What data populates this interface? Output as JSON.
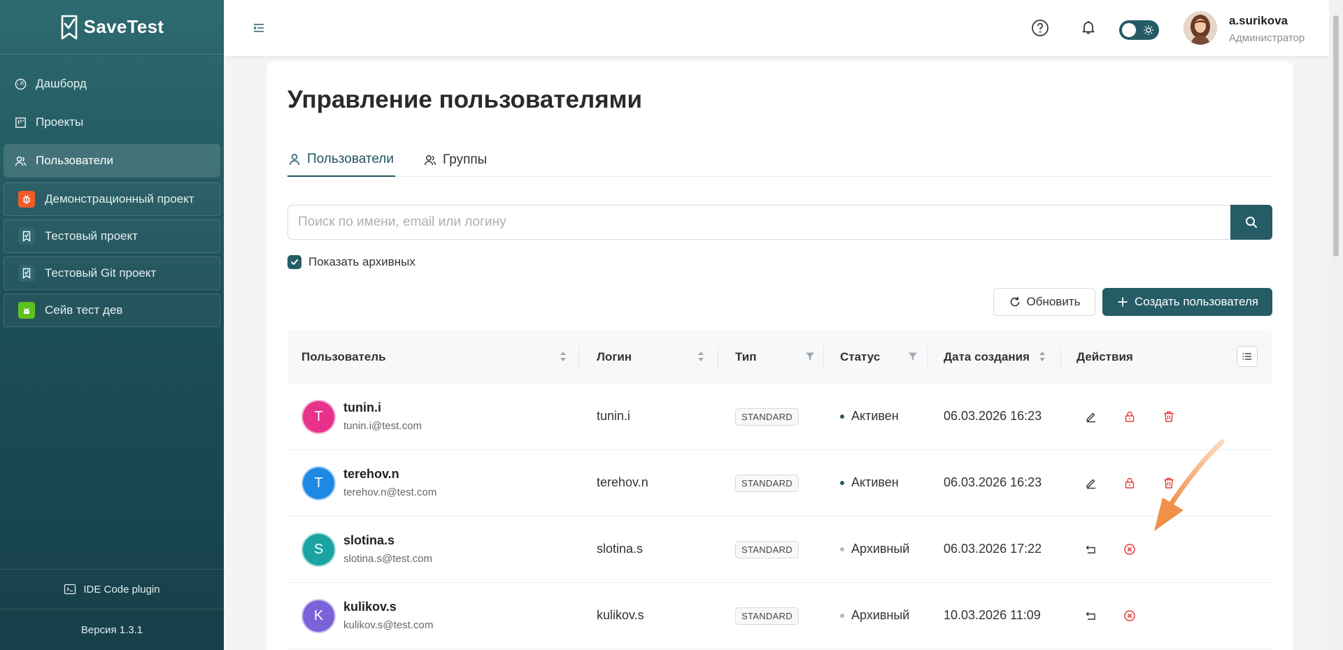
{
  "app": {
    "name": "SaveTest",
    "version": "Версия 1.3.1",
    "plugin_label": "IDE Code plugin"
  },
  "nav": [
    {
      "label": "Дашборд",
      "icon": "dashboard-icon"
    },
    {
      "label": "Проекты",
      "icon": "board-icon"
    },
    {
      "label": "Пользователи",
      "icon": "users-icon",
      "active": true
    }
  ],
  "projects": [
    {
      "label": "Демонстрационный проект",
      "icon": "bug-icon",
      "color": "#f05a28"
    },
    {
      "label": "Тестовый проект",
      "icon": "savetest-icon",
      "color": "#2f6670"
    },
    {
      "label": "Тестовый Git проект",
      "icon": "savetest-icon",
      "color": "#2f6670"
    },
    {
      "label": "Сейв тест дев",
      "icon": "android-icon",
      "color": "#5dc21e"
    }
  ],
  "header": {
    "user_name": "a.surikova",
    "user_role": "Администратор"
  },
  "page": {
    "title": "Управление пользователями",
    "tabs": [
      {
        "label": "Пользователи",
        "active": true
      },
      {
        "label": "Группы"
      }
    ],
    "search_placeholder": "Поиск по имени, email или логину",
    "show_archived_label": "Показать архивных",
    "show_archived_checked": true,
    "refresh_label": "Обновить",
    "create_label": "Создать пользователя"
  },
  "table": {
    "columns": [
      "Пользователь",
      "Логин",
      "Тип",
      "Статус",
      "Дата создания",
      "Действия"
    ],
    "rows": [
      {
        "initial": "T",
        "avatar_color": "#e8318b",
        "name": "tunin.i",
        "email": "tunin.i@test.com",
        "login": "tunin.i",
        "type": "STANDARD",
        "status": "Активен",
        "status_color": "#255c66",
        "date": "06.03.2026 16:23",
        "archived": false
      },
      {
        "initial": "T",
        "avatar_color": "#1e88e5",
        "name": "terehov.n",
        "email": "terehov.n@test.com",
        "login": "terehov.n",
        "type": "STANDARD",
        "status": "Активен",
        "status_color": "#255c66",
        "date": "06.03.2026 16:23",
        "archived": false
      },
      {
        "initial": "S",
        "avatar_color": "#1aa3a3",
        "name": "slotina.s",
        "email": "slotina.s@test.com",
        "login": "slotina.s",
        "type": "STANDARD",
        "status": "Архивный",
        "status_color": "#b5b9bc",
        "date": "06.03.2026 17:22",
        "archived": true
      },
      {
        "initial": "K",
        "avatar_color": "#7a62d9",
        "name": "kulikov.s",
        "email": "kulikov.s@test.com",
        "login": "kulikov.s",
        "type": "STANDARD",
        "status": "Архивный",
        "status_color": "#b5b9bc",
        "date": "10.03.2026 11:09",
        "archived": true
      }
    ]
  },
  "colors": {
    "accent": "#255c66",
    "danger": "#e53935",
    "annotation": "#f49a4b"
  }
}
